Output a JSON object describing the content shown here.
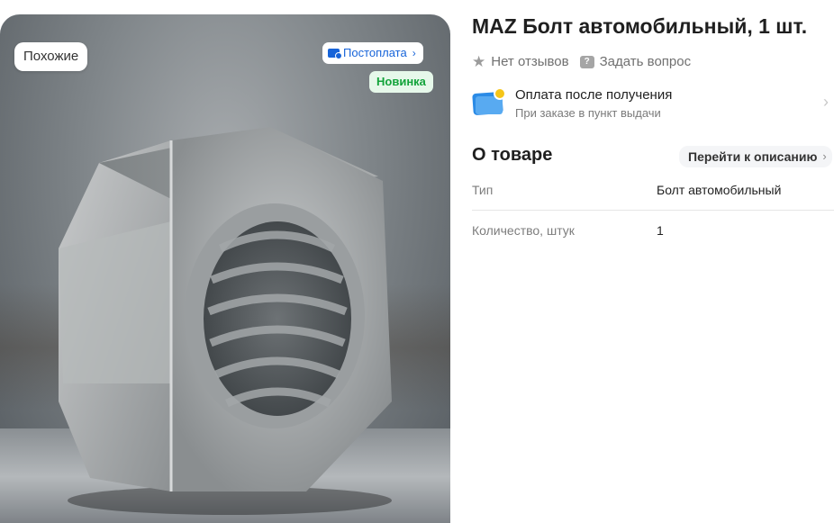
{
  "gallery": {
    "similar_label": "Похожие",
    "postpay_badge": "Постоплата",
    "new_badge": "Новинка",
    "image_icon": "hex-nut-photo"
  },
  "product": {
    "title": "MAZ Болт автомобильный, 1 шт.",
    "reviews_label": "Нет отзывов",
    "ask_label": "Задать вопрос"
  },
  "payment": {
    "title": "Оплата после получения",
    "subtitle": "При заказе в пункт выдачи"
  },
  "about": {
    "title": "О товаре",
    "to_description": "Перейти к описанию",
    "specs": [
      {
        "key": "Тип",
        "value": "Болт автомобильный"
      },
      {
        "key": "Количество, штук",
        "value": "1"
      }
    ]
  },
  "colors": {
    "accent_blue": "#1764d9",
    "new_green": "#12a33a",
    "coin_yellow": "#f5c518"
  }
}
